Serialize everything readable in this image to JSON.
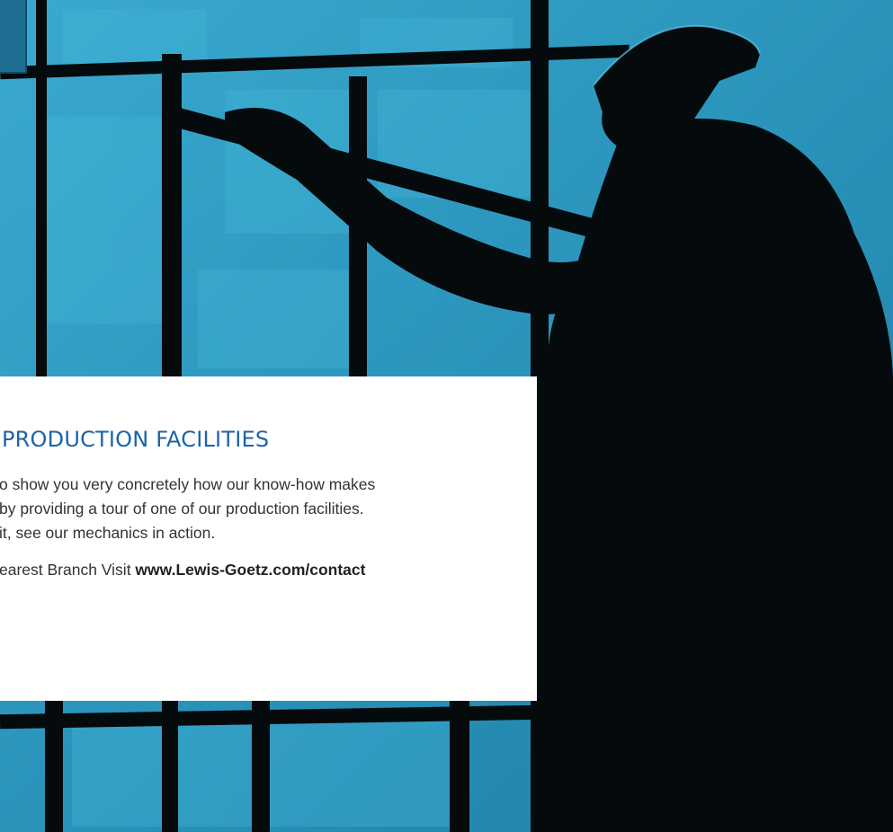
{
  "card": {
    "title": "PRODUCTION FACILITIES",
    "body_lines": [
      "o show you very concretely how our know-how makes",
      "by providing a tour of one of our production facilities.",
      "it, see our mechanics in action."
    ],
    "cta_text": "earest Branch Visit ",
    "cta_link": "www.Lewis-Goetz.com/contact"
  },
  "colors": {
    "accent": "#1c64a8",
    "background_tint": "#2f9fc4",
    "silhouette": "#050a0d"
  },
  "icons": {
    "hero": "worker-silhouette-photo"
  }
}
